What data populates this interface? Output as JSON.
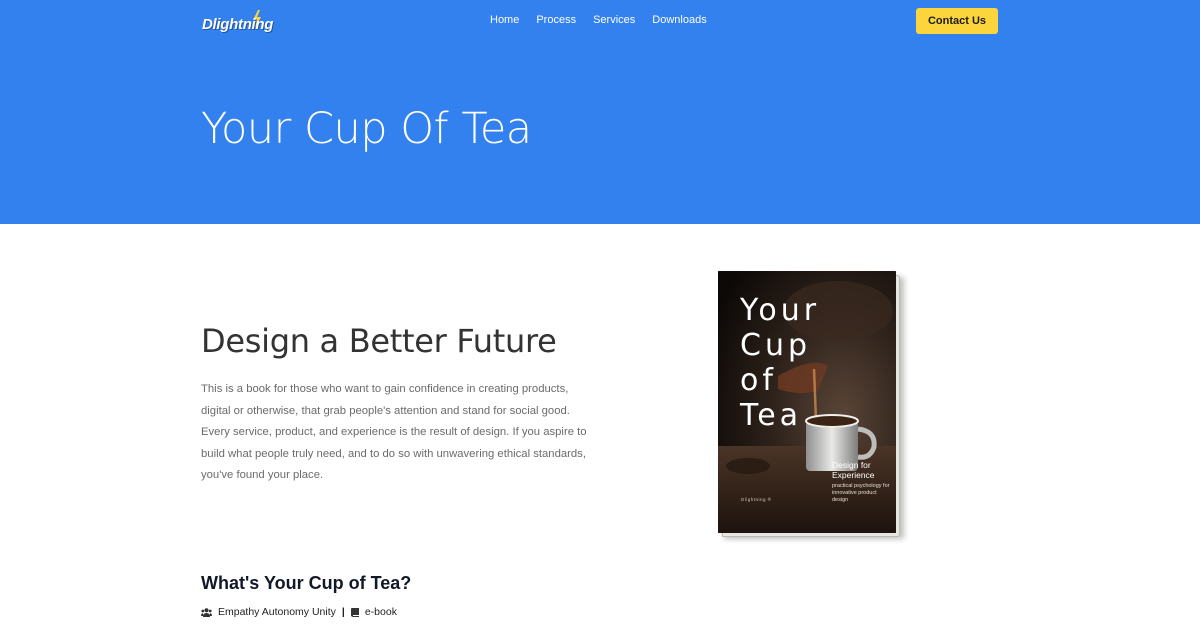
{
  "brand": {
    "name": "Dlightning",
    "accent": "#3281ee",
    "bolt_color": "#fcd53c"
  },
  "nav": {
    "items": [
      {
        "label": "Home"
      },
      {
        "label": "Process"
      },
      {
        "label": "Services"
      },
      {
        "label": "Downloads"
      }
    ],
    "cta_label": "Contact Us"
  },
  "hero": {
    "title": "Your Cup Of Tea"
  },
  "intro": {
    "heading": "Design a Better Future",
    "body": "This is a book for those who want to gain confidence in creating products, digital or otherwise, that grab people's attention and stand for social good. Every service, product, and experience is the result of design. If you aspire to build what people truly need, and to do so with unwavering ethical standards, you've found your place."
  },
  "book": {
    "title_lines": [
      "Your",
      "Cup",
      "of",
      "Tea"
    ],
    "subtitle": "Design for Experience",
    "tagline": "practical psychology for innovative product design",
    "author": "Dlightning ®"
  },
  "details": {
    "heading": "What's Your Cup of Tea?",
    "group_icon": "users-icon",
    "group_label": "Empathy Autonomy Unity",
    "separator": "|",
    "format_icon": "book-icon",
    "format_label": "e-book"
  }
}
